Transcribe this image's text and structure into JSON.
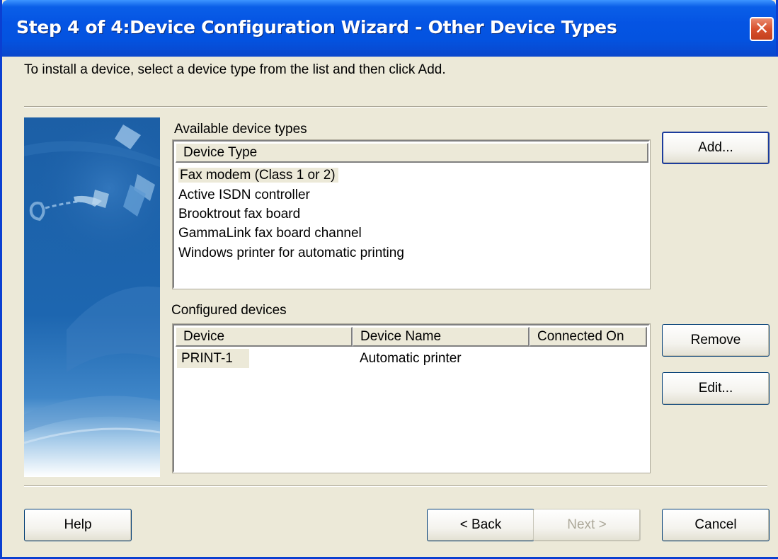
{
  "window": {
    "title": "Step 4 of 4:Device Configuration Wizard - Other Device Types",
    "close_glyph": "✕"
  },
  "instructions": "To install a device, select a device type from the list and then click Add.",
  "available": {
    "label": "Available device types",
    "column_header": "Device Type",
    "items": [
      "Fax modem (Class 1 or 2)",
      "Active ISDN controller",
      "Brooktrout fax board",
      "GammaLink fax board channel",
      "Windows printer for automatic printing"
    ],
    "selected_index": 0
  },
  "configured": {
    "label": "Configured devices",
    "columns": [
      "Device",
      "Device Name",
      "Connected On"
    ],
    "rows": [
      {
        "device": "PRINT-1",
        "device_name": "Automatic printer",
        "connected_on": ""
      }
    ]
  },
  "buttons": {
    "add": "Add...",
    "remove": "Remove",
    "edit": "Edit...",
    "help": "Help",
    "back": "< Back",
    "next": "Next >",
    "cancel": "Cancel"
  },
  "icons": {
    "close": "close-icon",
    "side_art": "wizard-banner-image"
  },
  "colors": {
    "titlebar": "#0554e3",
    "close_button": "#d8512e",
    "dialog_background": "#ece9d8",
    "side_art_blue": "#1a5aa0"
  }
}
